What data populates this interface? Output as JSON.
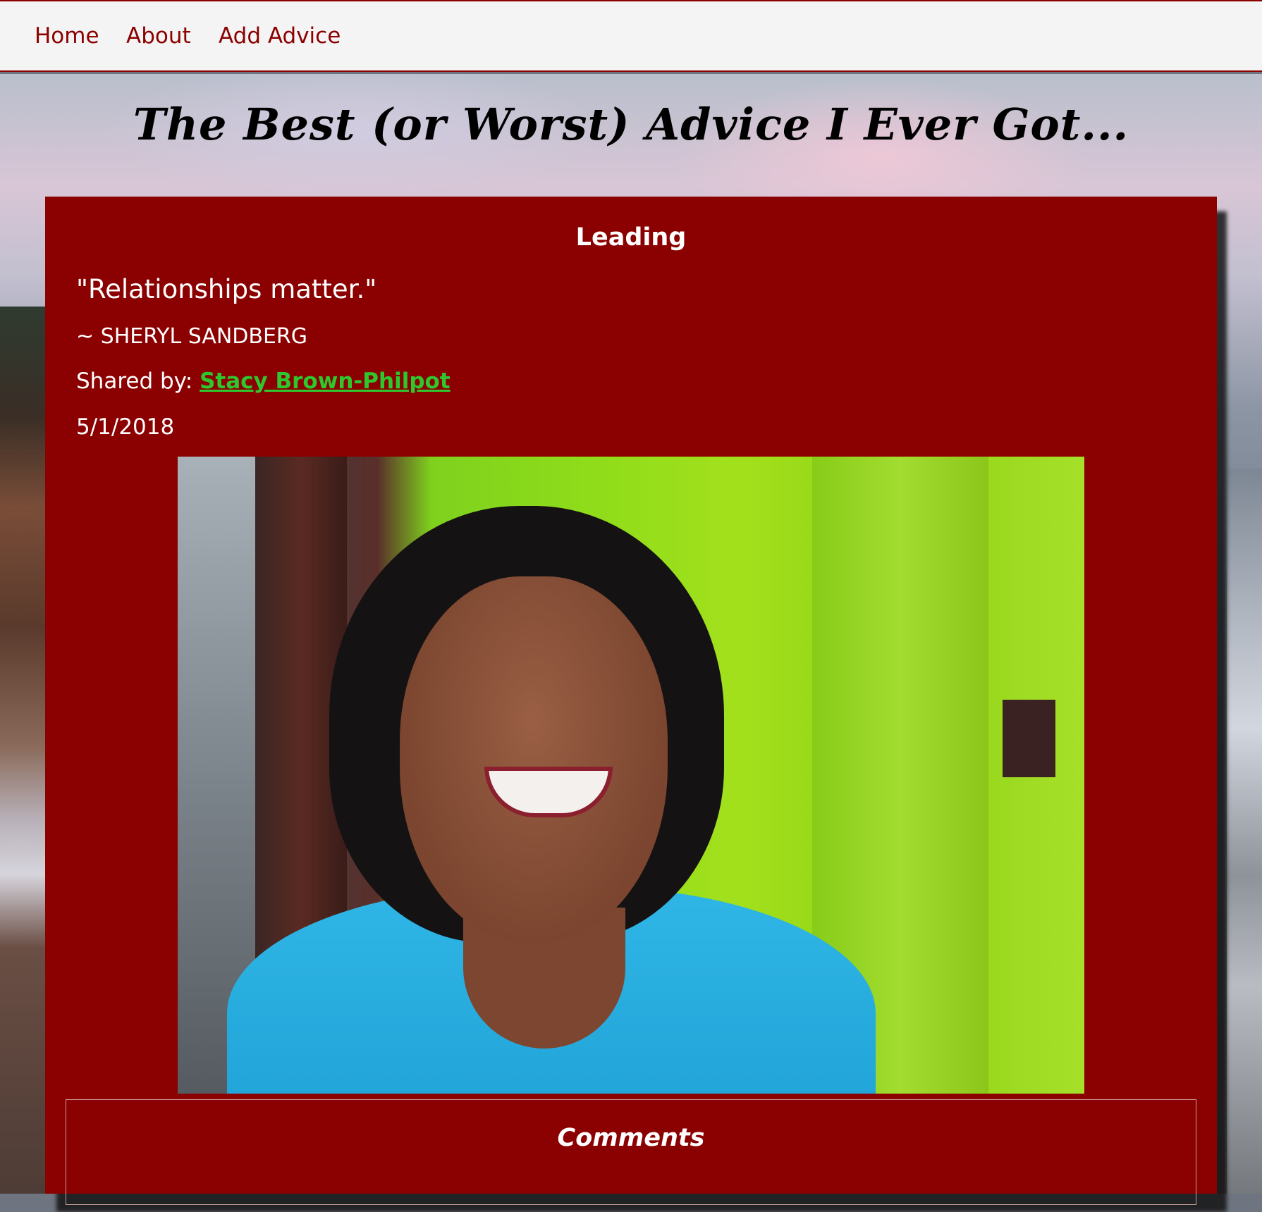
{
  "nav": {
    "home": "Home",
    "about": "About",
    "add_advice": "Add Advice"
  },
  "page": {
    "title": "The Best (or Worst) Advice I Ever Got..."
  },
  "advice": {
    "category": "Leading",
    "quote": "\"Relationships matter.\"",
    "author": "~ SHERYL SANDBERG",
    "shared_by_label": "Shared by: ",
    "shared_by_name": "Stacy Brown-Philpot",
    "date": "5/1/2018"
  },
  "comments": {
    "title": "Comments"
  },
  "colors": {
    "brand": "#8b0000",
    "link_green": "#2ec72e",
    "nav_bg": "#f4f4f4"
  }
}
